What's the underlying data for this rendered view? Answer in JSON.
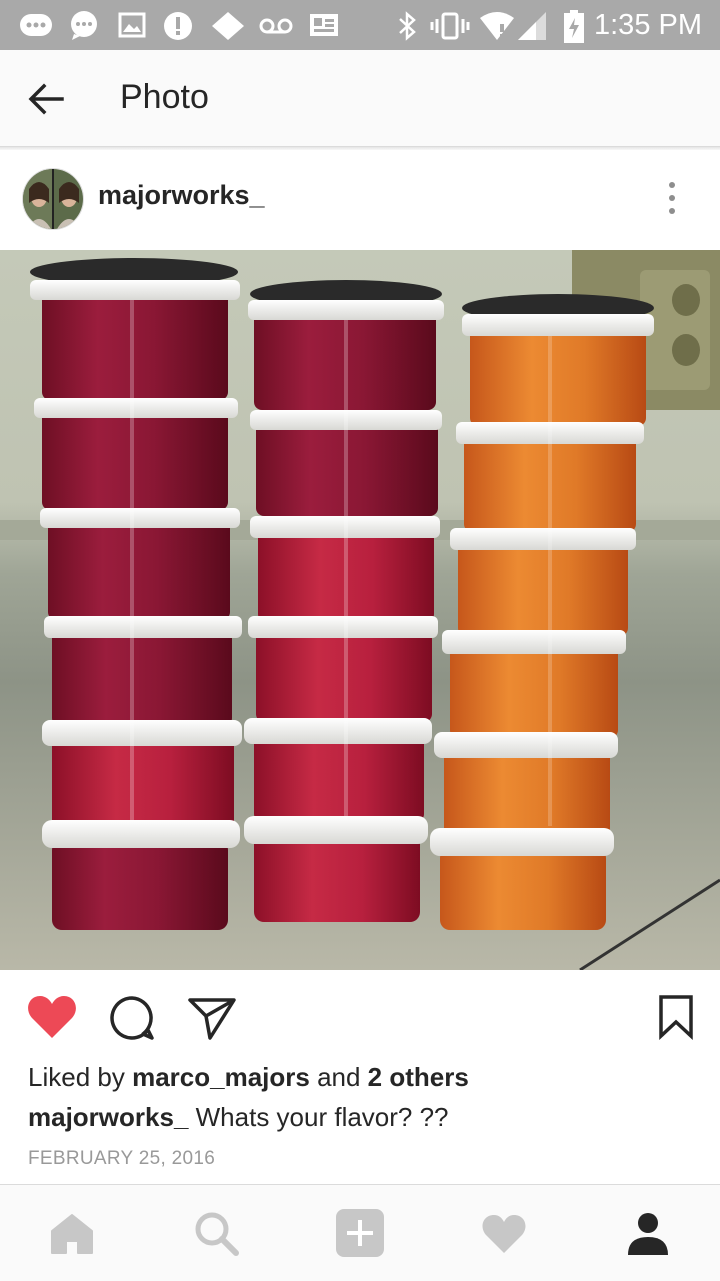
{
  "status_bar": {
    "time": "1:35 PM",
    "icons": [
      "chat-bubble-icon",
      "message-icon",
      "image-icon",
      "alert-icon",
      "diamond-icon",
      "voicemail-icon",
      "news-icon",
      "bluetooth-icon",
      "vibrate-icon",
      "wifi-icon",
      "signal-icon",
      "battery-charging-icon"
    ]
  },
  "app_bar": {
    "title": "Photo",
    "back_icon": "arrow-left-icon"
  },
  "post": {
    "username": "majorworks_",
    "more_icon": "more-vertical-icon",
    "photo_icon": "stacked-containers-photo"
  },
  "actions": {
    "like_icon": "heart-filled-icon",
    "comment_icon": "comment-icon",
    "share_icon": "send-icon",
    "save_icon": "bookmark-icon",
    "like_color": "#ed4956"
  },
  "likes": {
    "prefix": "Liked by ",
    "user": "marco_majors",
    "middle": " and ",
    "others": "2 others"
  },
  "caption": {
    "username": "majorworks_",
    "text": " Whats your flavor? ??"
  },
  "date": "FEBRUARY 25, 2016",
  "bottom_nav": {
    "items": [
      "home-icon",
      "search-icon",
      "add-icon",
      "activity-heart-icon",
      "profile-icon"
    ]
  },
  "colors": {
    "status_bar": "#a9a9a9",
    "nav_inactive": "#c7c7c7",
    "nav_active": "#262626"
  }
}
